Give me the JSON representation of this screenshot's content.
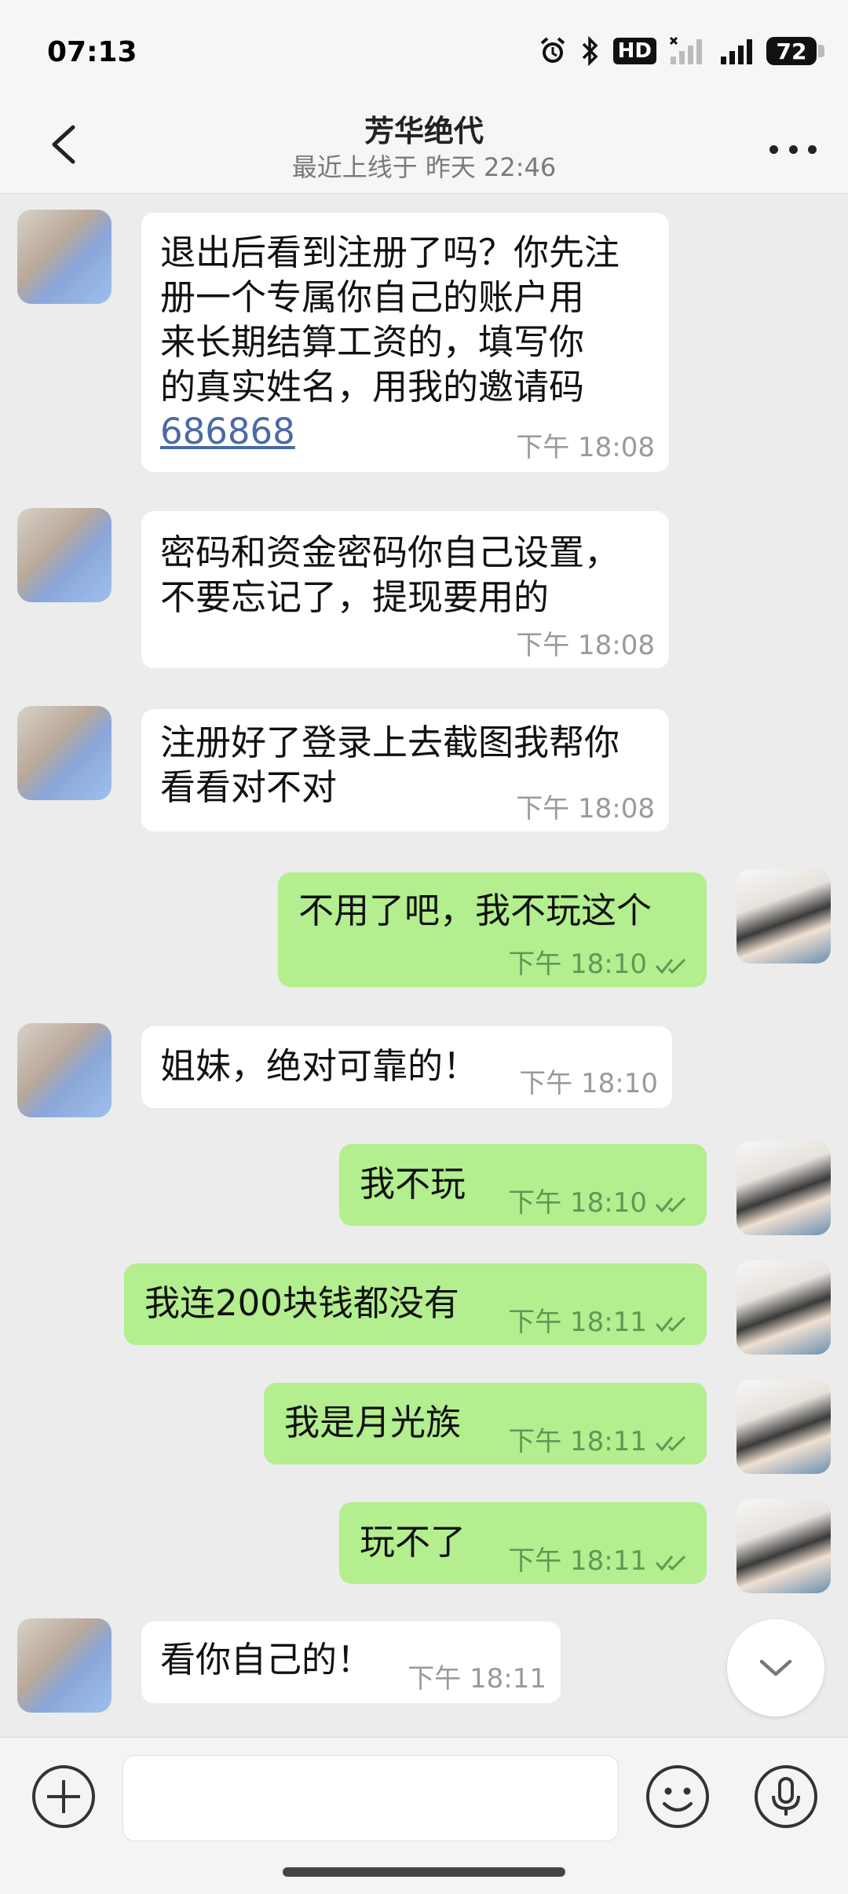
{
  "status_bar": {
    "time": "07:13",
    "icons": [
      "alarm-icon",
      "bluetooth-icon",
      "hd-icon",
      "signal-weak-icon",
      "signal-5g-icon",
      "battery-icon"
    ],
    "hd_label": "HD",
    "network": "5G",
    "battery": "72"
  },
  "header": {
    "title": "芳华绝代",
    "subtitle": "最近上线于 昨天 22:46"
  },
  "messages": [
    {
      "direction": "in",
      "lines": [
        "退出后看到注册了吗？你先注",
        "册一个专属你自己的账户用",
        "来长期结算工资的，填写你",
        "的真实姓名，用我的邀请码"
      ],
      "link": "686868",
      "time": "下午  18:08"
    },
    {
      "direction": "in",
      "lines": [
        "密码和资金密码你自己设置，",
        "不要忘记了，提现要用的"
      ],
      "time": "下午  18:08"
    },
    {
      "direction": "in",
      "lines": [
        "注册好了登录上去截图我帮你",
        "看看对不对"
      ],
      "time": "下午  18:08"
    },
    {
      "direction": "out",
      "lines": [
        "不用了吧，我不玩这个"
      ],
      "time": "下午  18:10"
    },
    {
      "direction": "in",
      "lines": [
        "姐妹，绝对可靠的！"
      ],
      "time": "下午  18:10"
    },
    {
      "direction": "out",
      "lines": [
        "我不玩"
      ],
      "time": "下午  18:10"
    },
    {
      "direction": "out",
      "lines": [
        "我连200块钱都没有"
      ],
      "time": "下午  18:11"
    },
    {
      "direction": "out",
      "lines": [
        "我是月光族"
      ],
      "time": "下午  18:11"
    },
    {
      "direction": "out",
      "lines": [
        "玩不了"
      ],
      "time": "下午  18:11"
    },
    {
      "direction": "in",
      "lines": [
        "看你自己的！"
      ],
      "time": "下午  18:11"
    }
  ],
  "input_bar": {
    "placeholder": "",
    "icons": [
      "plus-icon",
      "emoji-icon",
      "microphone-icon"
    ]
  },
  "colors": {
    "outgoing_bubble": "#b3ee8f",
    "incoming_bubble": "#ffffff",
    "chat_background": "#ececec"
  }
}
